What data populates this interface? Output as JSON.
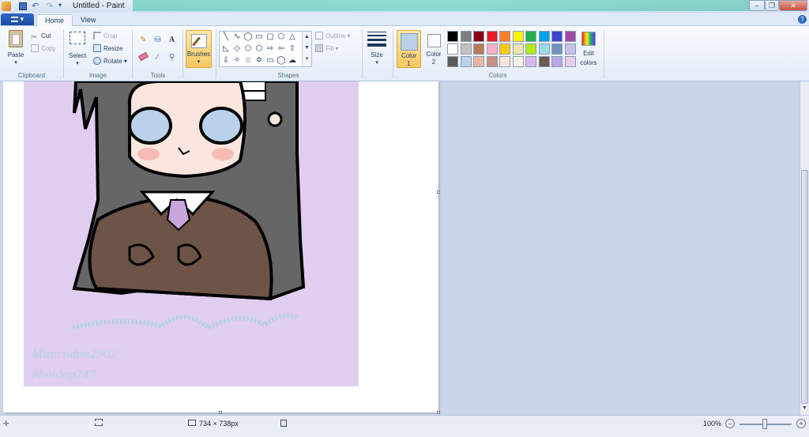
{
  "window": {
    "title": "Untitled - Paint"
  },
  "menu": {
    "file_button": "▾",
    "tabs": [
      "Home",
      "View"
    ]
  },
  "clipboard": {
    "paste": "Paste",
    "cut": "Cut",
    "copy": "Copy",
    "label": "Clipboard"
  },
  "image": {
    "select": "Select",
    "crop": "Crop",
    "resize": "Resize",
    "rotate": "Rotate",
    "label": "Image"
  },
  "tools": {
    "label": "Tools"
  },
  "brushes": {
    "label": "Brushes"
  },
  "shapes": {
    "outline": "Outline",
    "fill": "Fill",
    "label": "Shapes"
  },
  "size": {
    "label": "Size"
  },
  "color1": {
    "label": "Color",
    "num": "1",
    "value": "#b9d1ea"
  },
  "color2": {
    "label": "Color",
    "num": "2",
    "value": "#ffffff"
  },
  "colors": {
    "label": "Colors",
    "edit_label": "Edit",
    "edit_label2": "colors",
    "palette": [
      [
        "#000000",
        "#7f7f7f",
        "#880015",
        "#ed1c24",
        "#ff7f27",
        "#fff200",
        "#22b14c",
        "#00a2e8",
        "#3f48cc",
        "#a349a4"
      ],
      [
        "#ffffff",
        "#c3c3c3",
        "#b97a57",
        "#ffaec9",
        "#ffc90e",
        "#efe4b0",
        "#b5e61d",
        "#99d9ea",
        "#7092be",
        "#c8bfe7"
      ],
      [
        "#5a5a5a",
        "#b9d1ea",
        "#e6b8a2",
        "#c8907e",
        "#fbe6df",
        "#f2f2e6",
        "#d8b8e8",
        "#6c5a50",
        "#b8a8e8",
        "#e4d0ec"
      ]
    ]
  },
  "artwork": {
    "watermark_line1": "Mintcodon2902",
    "watermark_line2": "#hoidap247",
    "background": "#e0cef0"
  },
  "status": {
    "size": "734 × 738px",
    "zoom": "100%"
  }
}
